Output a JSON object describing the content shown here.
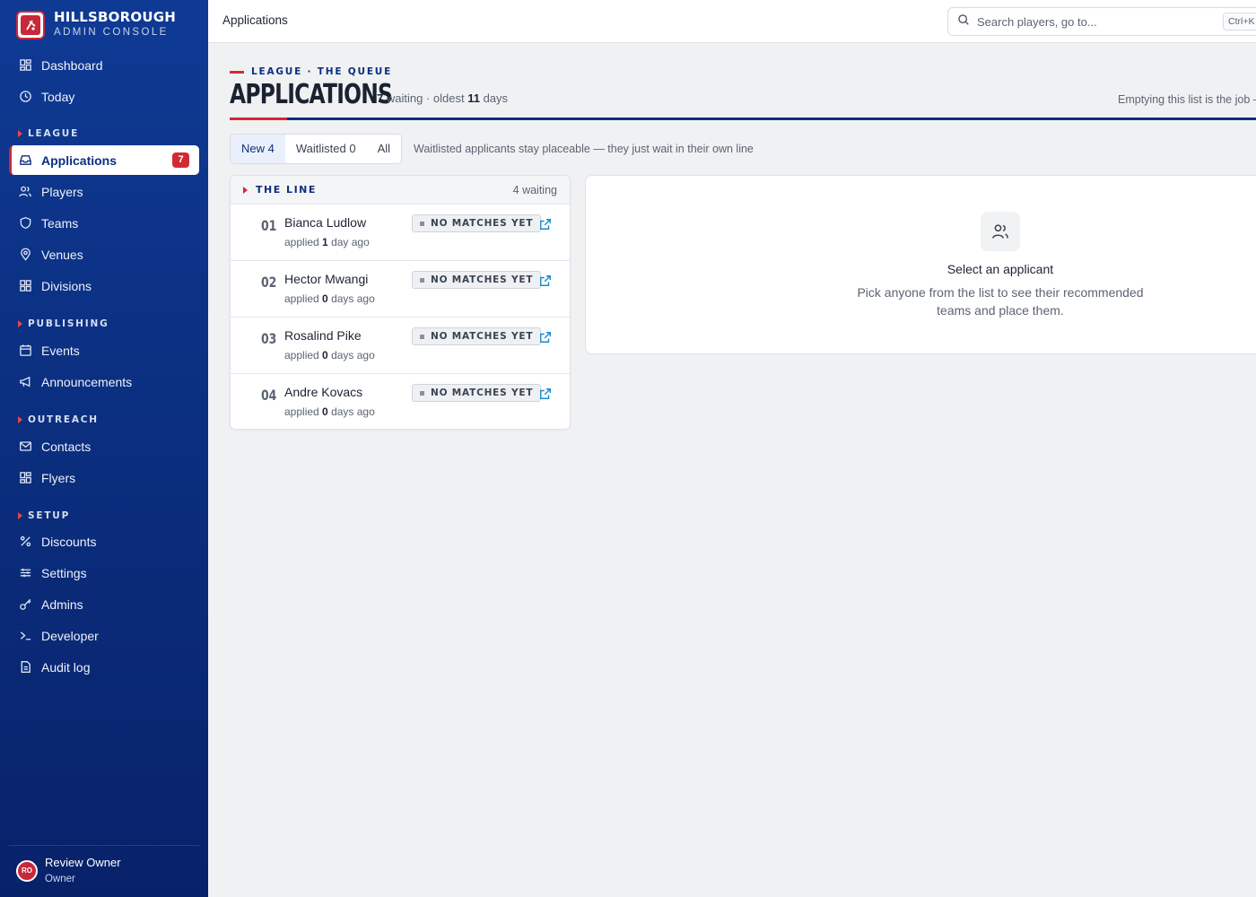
{
  "brand": {
    "title": "HILLSBOROUGH",
    "subtitle": "ADMIN CONSOLE"
  },
  "sidebar": {
    "top_items": [
      {
        "label": "Dashboard",
        "icon": "dashboard-icon"
      },
      {
        "label": "Today",
        "icon": "clock-icon"
      }
    ],
    "sections": [
      {
        "label": "LEAGUE",
        "items": [
          {
            "label": "Applications",
            "icon": "inbox-icon",
            "active": true,
            "badge": "7"
          },
          {
            "label": "Players",
            "icon": "users-icon"
          },
          {
            "label": "Teams",
            "icon": "shield-icon"
          },
          {
            "label": "Venues",
            "icon": "map-pin-icon"
          },
          {
            "label": "Divisions",
            "icon": "grid-icon"
          }
        ]
      },
      {
        "label": "PUBLISHING",
        "items": [
          {
            "label": "Events",
            "icon": "calendar-icon"
          },
          {
            "label": "Announcements",
            "icon": "megaphone-icon"
          }
        ]
      },
      {
        "label": "OUTREACH",
        "items": [
          {
            "label": "Contacts",
            "icon": "mail-icon"
          },
          {
            "label": "Flyers",
            "icon": "grid-icon"
          }
        ]
      },
      {
        "label": "SETUP",
        "items": [
          {
            "label": "Discounts",
            "icon": "percent-icon"
          },
          {
            "label": "Settings",
            "icon": "sliders-icon"
          },
          {
            "label": "Admins",
            "icon": "key-icon"
          },
          {
            "label": "Developer",
            "icon": "terminal-icon"
          },
          {
            "label": "Audit log",
            "icon": "file-icon"
          }
        ]
      }
    ],
    "user": {
      "initials": "RO",
      "name": "Review Owner",
      "role": "Owner"
    }
  },
  "topbar": {
    "title": "Applications",
    "search_placeholder": "Search players, go to...",
    "shortcut": "Ctrl+K"
  },
  "header": {
    "eyebrow": "LEAGUE · THE QUEUE",
    "title": "APPLICATIONS",
    "waiting_count": "7",
    "waiting_label": "waiting · oldest",
    "oldest_days": "11",
    "days_label": "days",
    "right_note": "Emptying this list is the job —"
  },
  "tabs": [
    {
      "label": "New 4",
      "active": true
    },
    {
      "label": "Waitlisted 0",
      "active": false
    },
    {
      "label": "All",
      "active": false
    }
  ],
  "tabs_note": "Waitlisted applicants stay placeable — they just wait in their own line",
  "queue": {
    "heading": "THE LINE",
    "count": "4 waiting",
    "rows": [
      {
        "num": "01",
        "name": "Bianca Ludlow",
        "applied_prefix": "applied",
        "applied_value": "1",
        "applied_unit": "day ago",
        "status": "NO MATCHES YET"
      },
      {
        "num": "02",
        "name": "Hector Mwangi",
        "applied_prefix": "applied",
        "applied_value": "0",
        "applied_unit": "days ago",
        "status": "NO MATCHES YET"
      },
      {
        "num": "03",
        "name": "Rosalind Pike",
        "applied_prefix": "applied",
        "applied_value": "0",
        "applied_unit": "days ago",
        "status": "NO MATCHES YET"
      },
      {
        "num": "04",
        "name": "Andre Kovacs",
        "applied_prefix": "applied",
        "applied_value": "0",
        "applied_unit": "days ago",
        "status": "NO MATCHES YET"
      }
    ]
  },
  "detail": {
    "empty_title": "Select an applicant",
    "empty_desc": "Pick anyone from the list to see their recommended teams and place them."
  },
  "colors": {
    "navy": "#0d2f7e",
    "red": "#d22a34",
    "link": "#1a8ac8"
  }
}
